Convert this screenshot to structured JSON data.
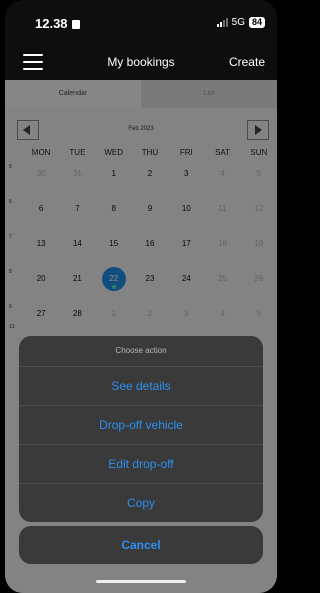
{
  "status": {
    "time": "12.38",
    "network": "5G",
    "battery": "84"
  },
  "nav": {
    "title": "My bookings",
    "create": "Create"
  },
  "tabs": [
    {
      "label": "Calendar"
    },
    {
      "label": "List"
    }
  ],
  "calendar": {
    "month_label": "Feb 2023",
    "weekdays": [
      "MON",
      "TUE",
      "WED",
      "THU",
      "FRI",
      "SAT",
      "SUN"
    ],
    "weeks": [
      {
        "num": "5",
        "days": [
          "30",
          "31",
          "1",
          "2",
          "3",
          "4",
          "5"
        ]
      },
      {
        "num": "6",
        "days": [
          "6",
          "7",
          "8",
          "9",
          "10",
          "11",
          "12"
        ]
      },
      {
        "num": "7",
        "days": [
          "13",
          "14",
          "15",
          "16",
          "17",
          "18",
          "19"
        ]
      },
      {
        "num": "8",
        "days": [
          "20",
          "21",
          "22",
          "23",
          "24",
          "25",
          "26"
        ]
      },
      {
        "num": "9",
        "days": [
          "27",
          "28",
          "1",
          "2",
          "3",
          "4",
          "5"
        ]
      }
    ],
    "extra_week_num": "13"
  },
  "action_sheet": {
    "title": "Choose action",
    "items": [
      {
        "label": "See details"
      },
      {
        "label": "Drop-off vehicle"
      },
      {
        "label": "Edit drop-off"
      },
      {
        "label": "Copy"
      }
    ],
    "cancel": "Cancel"
  },
  "colors": {
    "accent": "#2e8ff0",
    "today": "#1f8fe6",
    "event_dot": "#5de3b0"
  }
}
